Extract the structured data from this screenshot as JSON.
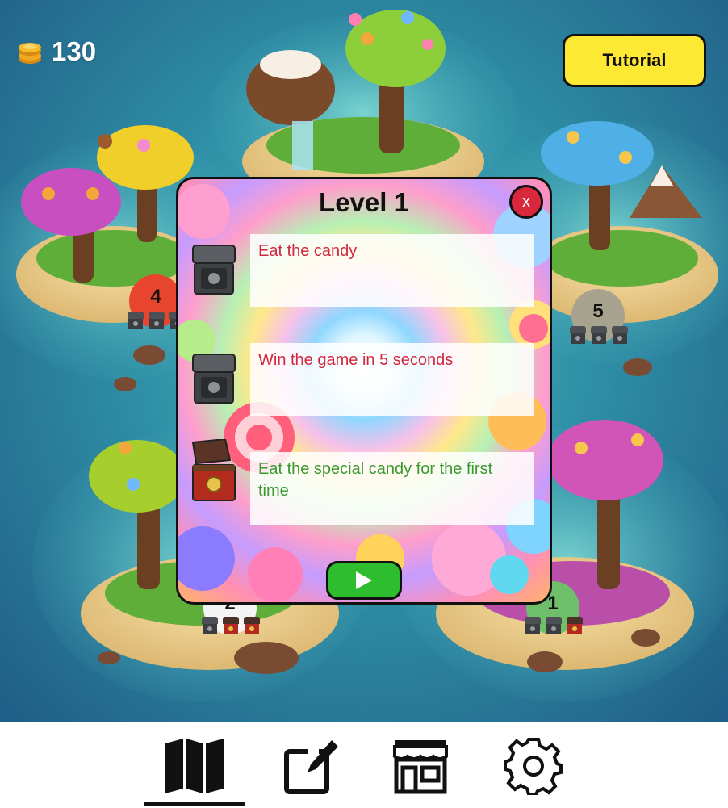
{
  "header": {
    "coins": "130",
    "coin_icon": "coin-stack-icon",
    "tutorial_label": "Tutorial"
  },
  "map": {
    "levels": [
      {
        "number": "4",
        "badge_color": "#e8452e",
        "chests": [
          "grey",
          "grey",
          "grey"
        ]
      },
      {
        "number": "5",
        "badge_color": "#a8a38f",
        "chests": [
          "grey",
          "grey",
          "grey"
        ]
      },
      {
        "number": "2",
        "badge_color": "#f4f4f4",
        "chests": [
          "grey",
          "red",
          "red"
        ]
      },
      {
        "number": "1",
        "badge_color": "#6fbf6a",
        "chests": [
          "grey",
          "grey",
          "red"
        ]
      }
    ]
  },
  "modal": {
    "title": "Level 1",
    "close_label": "x",
    "quests": [
      {
        "text": "Eat the candy",
        "status": "incomplete",
        "reward_icon": "locked-chest-icon"
      },
      {
        "text": "Win the game in 5 seconds",
        "status": "incomplete",
        "reward_icon": "locked-chest-icon"
      },
      {
        "text": "Eat the special candy for the first time",
        "status": "complete",
        "reward_icon": "open-treasure-chest-icon"
      }
    ],
    "play_icon": "play-icon"
  },
  "nav": {
    "items": [
      {
        "name": "map",
        "icon": "map-icon",
        "active": true
      },
      {
        "name": "edit",
        "icon": "edit-icon",
        "active": false
      },
      {
        "name": "shop",
        "icon": "shop-icon",
        "active": false
      },
      {
        "name": "settings",
        "icon": "gear-icon",
        "active": false
      }
    ]
  },
  "colors": {
    "tutorial_bg": "#fde834",
    "close_bg": "#d9283c",
    "play_bg": "#2ebd2e",
    "incomplete_text": "#d1283e",
    "complete_text": "#3a9a2f"
  }
}
